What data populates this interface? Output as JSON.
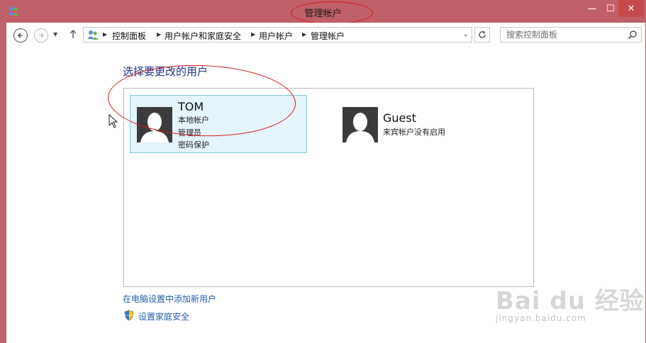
{
  "window": {
    "title": "管理帐户",
    "controls": {
      "minimize": "—",
      "maximize": "☐",
      "close": "✕"
    }
  },
  "address_bar": {
    "breadcrumbs": [
      "控制面板",
      "用户帐户和家庭安全",
      "用户帐户",
      "管理帐户"
    ],
    "search_placeholder": "搜索控制面板"
  },
  "main": {
    "heading": "选择要更改的用户",
    "accounts": [
      {
        "name": "TOM",
        "details": [
          "本地帐户",
          "管理员",
          "密码保护"
        ],
        "selected": true
      },
      {
        "name": "Guest",
        "details": [
          "来宾帐户没有启用"
        ],
        "selected": false
      }
    ],
    "links": {
      "add_user": "在电脑设置中添加新用户",
      "family_safety": "设置家庭安全"
    }
  },
  "watermark": {
    "brand": "Bai du 经验",
    "url": "jingyan.baidu.com"
  },
  "colors": {
    "titlebar": "#c0606a",
    "heading": "#1e3287",
    "link": "#1f5fb4",
    "selection": "#e5f3fb",
    "annotation": "#d41919"
  }
}
